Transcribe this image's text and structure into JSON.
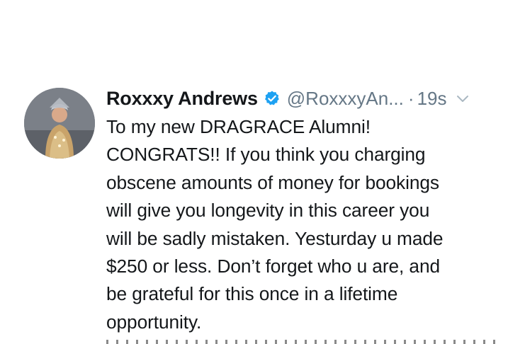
{
  "tweet": {
    "author_name": "Roxxxy Andrews",
    "handle": "@RoxxxyAn...",
    "separator": "·",
    "timestamp": "19s",
    "body_lines": [
      "To my new DRAGRACE Alumni!",
      "CONGRATS!! If you think you charging",
      "obscene amounts of money for bookings",
      "will give you longevity in this career you",
      "will be sadly mistaken. Yesturday u made",
      "$250 or less. Don’t forget who u are, and",
      "be grateful for this once in a lifetime",
      "opportunity."
    ]
  },
  "icons": {
    "verified": "verified-badge-icon",
    "caret": "chevron-down-icon"
  },
  "colors": {
    "text": "#14171a",
    "secondary": "#657786",
    "verified_blue": "#1da1f2",
    "background": "#ffffff"
  }
}
